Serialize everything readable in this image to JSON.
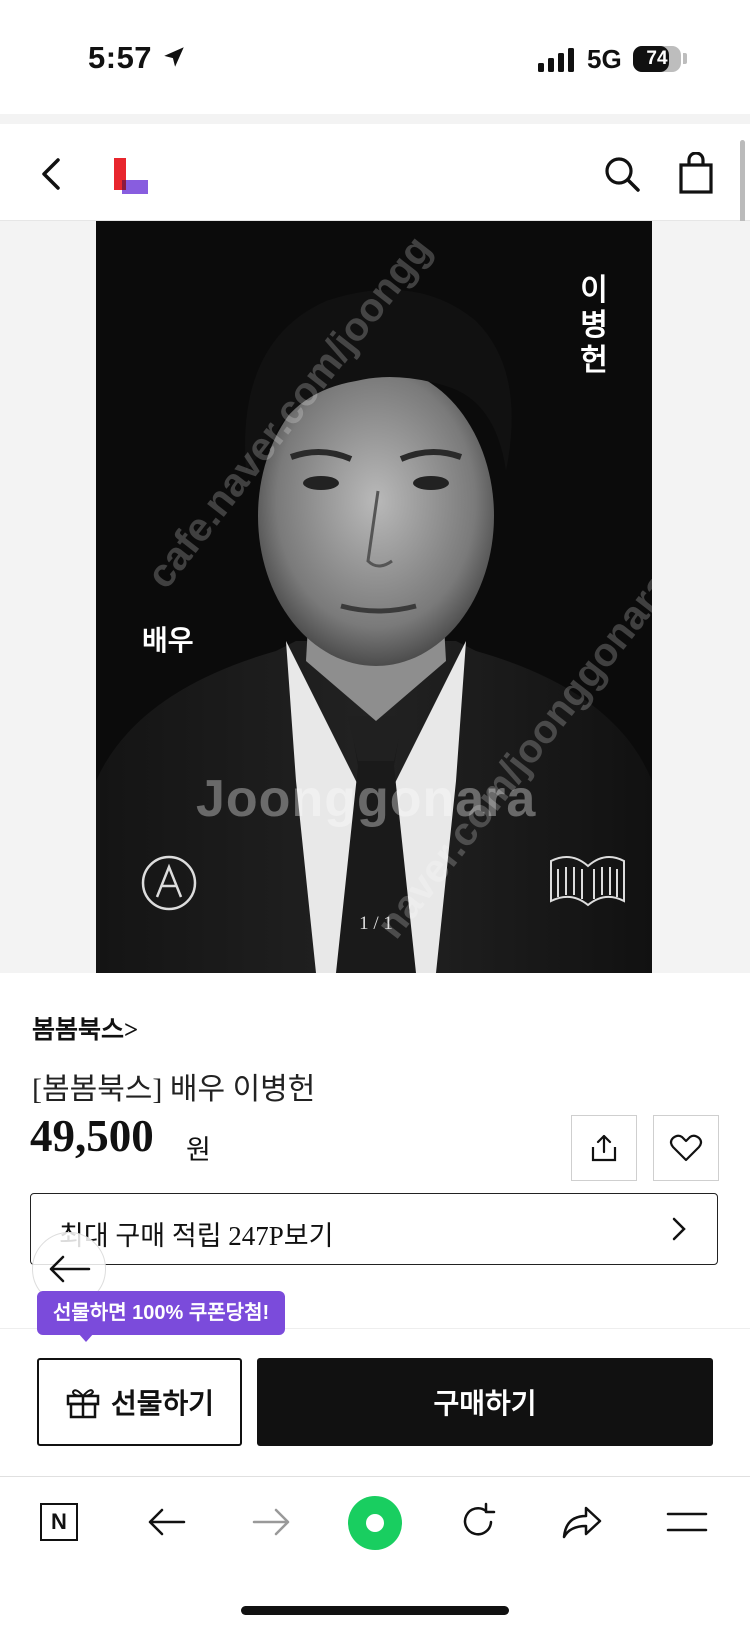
{
  "status_bar": {
    "time": "5:57",
    "network": "5G",
    "battery": "74",
    "battery_level": 0.74
  },
  "header": {
    "logo_icon": "lotteon-logo",
    "icons": [
      "back-icon",
      "search-icon",
      "shopping-bag-icon"
    ]
  },
  "cover": {
    "author_name": "이병헌",
    "book_title": "배우",
    "page_indicator": "1 / 1",
    "watermark_text": "Joonggonara",
    "watermark_url": "cafe.naver.com/joonggonara"
  },
  "product": {
    "brand_link": "봄봄북스>",
    "name": "[봄봄북스] 배우 이병헌",
    "price": "49,500",
    "currency": "원"
  },
  "points": {
    "label": "최대 구매 적립 247P보기"
  },
  "purchase": {
    "tooltip": "선물하면 100% 쿠폰당첨!",
    "gift_label": "선물하기",
    "buy_label": "구매하기"
  },
  "browser_toolbar": {
    "naver_label": "N",
    "icons": [
      "naver-n-icon",
      "back-arrow-icon",
      "forward-arrow-icon",
      "green-dot-icon",
      "refresh-icon",
      "share-icon",
      "menu-icon"
    ]
  },
  "colors": {
    "accent_purple": "#7b4bdb",
    "logo_red": "#e8262d",
    "logo_purple": "#7b4bdb",
    "naver_green": "#19ce60"
  }
}
